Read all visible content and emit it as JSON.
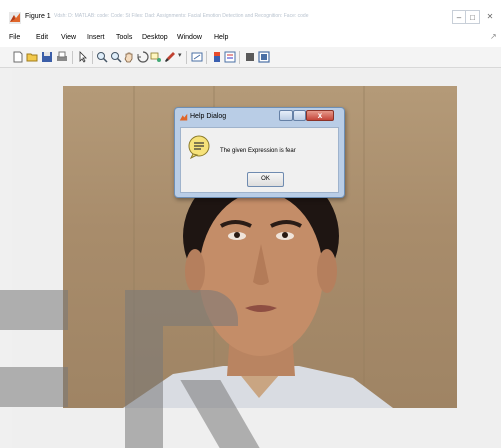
{
  "window": {
    "title": "Figure 1",
    "path": "Vdsh: D: MATLAB: code: Code: St Files: Dad: Assignments: Facial Emotion Detection and Recognition: Face: code",
    "controls": [
      "minimize",
      "maximize",
      "close"
    ]
  },
  "menu": [
    "File",
    "Edit",
    "View",
    "Insert",
    "Tools",
    "Desktop",
    "Window",
    "Help"
  ],
  "toolbar": {
    "icons": [
      "new-figure-icon",
      "open-icon",
      "save-icon",
      "print-icon",
      "select-arrow-icon",
      "zoom-in-icon",
      "zoom-out-icon",
      "pan-icon",
      "rotate-icon",
      "data-cursor-icon",
      "brush-icon",
      "dropdown-arrow-icon",
      "link-plot-icon",
      "colorbar-icon",
      "legend-icon",
      "hide-plot-tools-icon",
      "show-plot-tools-icon"
    ]
  },
  "dialog": {
    "title": "Help Dialog",
    "message": "The given Expression is fear",
    "ok_label": "OK",
    "close_glyph": "x"
  },
  "colors": {
    "dialog_frame": "#b9cde6",
    "close_button": "#c4463a",
    "figure_bg": "#efefef"
  }
}
